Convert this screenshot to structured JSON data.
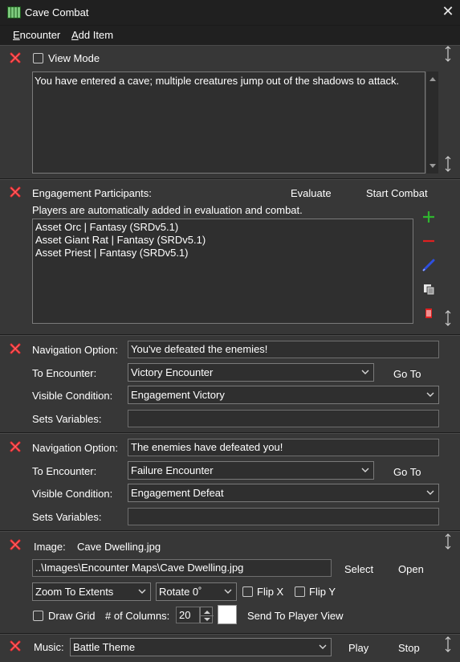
{
  "window": {
    "title": "Cave Combat",
    "close_glyph": "✕"
  },
  "menu": {
    "items": [
      "Encounter",
      "Add Item"
    ]
  },
  "view_panel": {
    "view_mode_label": "View Mode",
    "view_mode_checked": false,
    "text": "You have entered a cave; multiple creatures jump out of the shadows to attack."
  },
  "engagement": {
    "title": "Engagement Participants:",
    "evaluate": "Evaluate",
    "start_combat": "Start Combat",
    "note": "Players are automatically added in evaluation and combat.",
    "participants": [
      "Asset Orc | Fantasy (SRDv5.1)",
      "Asset Giant Rat | Fantasy (SRDv5.1)",
      "Asset Priest | Fantasy (SRDv5.1)"
    ]
  },
  "navigations": [
    {
      "option_label": "Navigation Option:",
      "option_value": "You've defeated the enemies!",
      "to_label": "To Encounter:",
      "to_value": "Victory Encounter",
      "goto": "Go To",
      "visible_label": "Visible Condition:",
      "visible_value": "Engagement Victory",
      "sets_label": "Sets Variables:",
      "sets_value": ""
    },
    {
      "option_label": "Navigation Option:",
      "option_value": "The enemies have defeated you!",
      "to_label": "To Encounter:",
      "to_value": "Failure Encounter",
      "goto": "Go To",
      "visible_label": "Visible Condition:",
      "visible_value": "Engagement Defeat",
      "sets_label": "Sets Variables:",
      "sets_value": ""
    }
  ],
  "image_panel": {
    "label": "Image:",
    "file_name": "Cave Dwelling.jpg",
    "path": "..\\Images\\Encounter Maps\\Cave Dwelling.jpg",
    "select": "Select",
    "open": "Open",
    "zoom_value": "Zoom To Extents",
    "rotate_value": "Rotate 0˚",
    "flip_x": "Flip X",
    "flip_y": "Flip Y",
    "draw_grid": "Draw Grid",
    "columns_label": "# of Columns:",
    "columns_value": "20",
    "send_to_player": "Send To Player View"
  },
  "music_panel": {
    "label": "Music:",
    "track": "Battle Theme",
    "play": "Play",
    "stop": "Stop"
  },
  "colors": {
    "delete_red": "#e0282d",
    "add_green": "#2fb52f",
    "remove_red": "#e02020",
    "edit_blue": "#2d4fe0",
    "panel_bg": "#373737",
    "field_bg": "#2f2f2f"
  },
  "icons": [
    "app-grid-icon",
    "close-icon",
    "delete-x-icon",
    "add-plus-icon",
    "remove-minus-icon",
    "edit-pencil-icon",
    "copy-list-icon",
    "clipboard-list-icon",
    "resize-handle-icon",
    "chevron-down-icon",
    "spin-up-icon",
    "spin-down-icon"
  ]
}
